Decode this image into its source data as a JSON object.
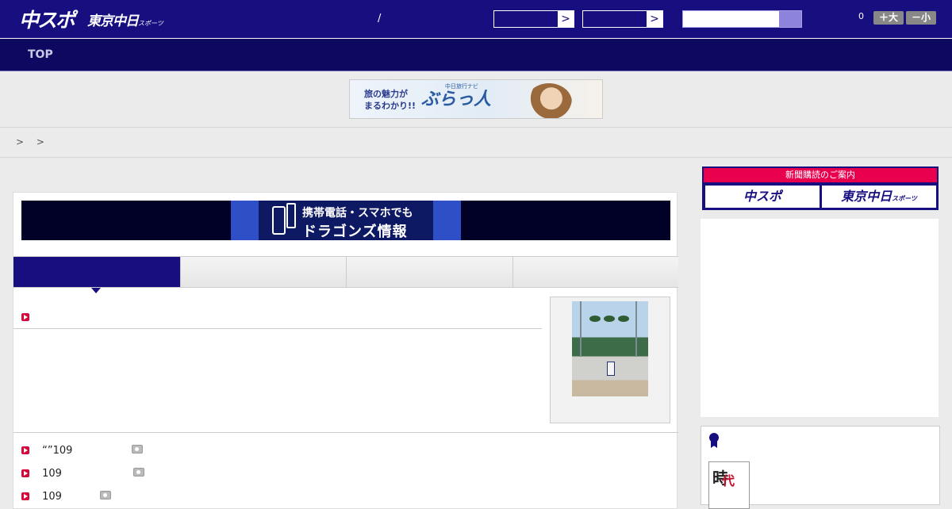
{
  "header": {
    "logo_chunichi": "中スポ",
    "logo_tokyo": "東京中日",
    "logo_tokyo_small": "スポーツ",
    "slash": "/",
    "select1_arrow": ">",
    "select2_arrow": ">",
    "font_count": "0",
    "font_bigger": "＋大",
    "font_smaller": "－小"
  },
  "nav": {
    "top_label": "TOP"
  },
  "banner": {
    "text": "旅の魅力が\nまるわかり!!",
    "brand": "ぶらっ人",
    "sub": "中日旅行ナビ"
  },
  "breadcrumb": "> >",
  "mobile_banner": {
    "line1": "携帯電話・スマホでも",
    "line2": "ドラゴンズ情報"
  },
  "articles": [
    {
      "title": "“”109"
    },
    {
      "title": "109"
    },
    {
      "title": "109"
    }
  ],
  "sidebar": {
    "subscribe_header": "新聞購読のご案内",
    "subscribe_chunichi": "中スポ",
    "subscribe_tokyo": "東京中日",
    "subscribe_tokyo_small": "スポーツ",
    "book_char1": "時",
    "book_char2": "代"
  },
  "colors": {
    "primary": "#170f80",
    "nav": "#0e0960",
    "accent": "#d6083b"
  }
}
